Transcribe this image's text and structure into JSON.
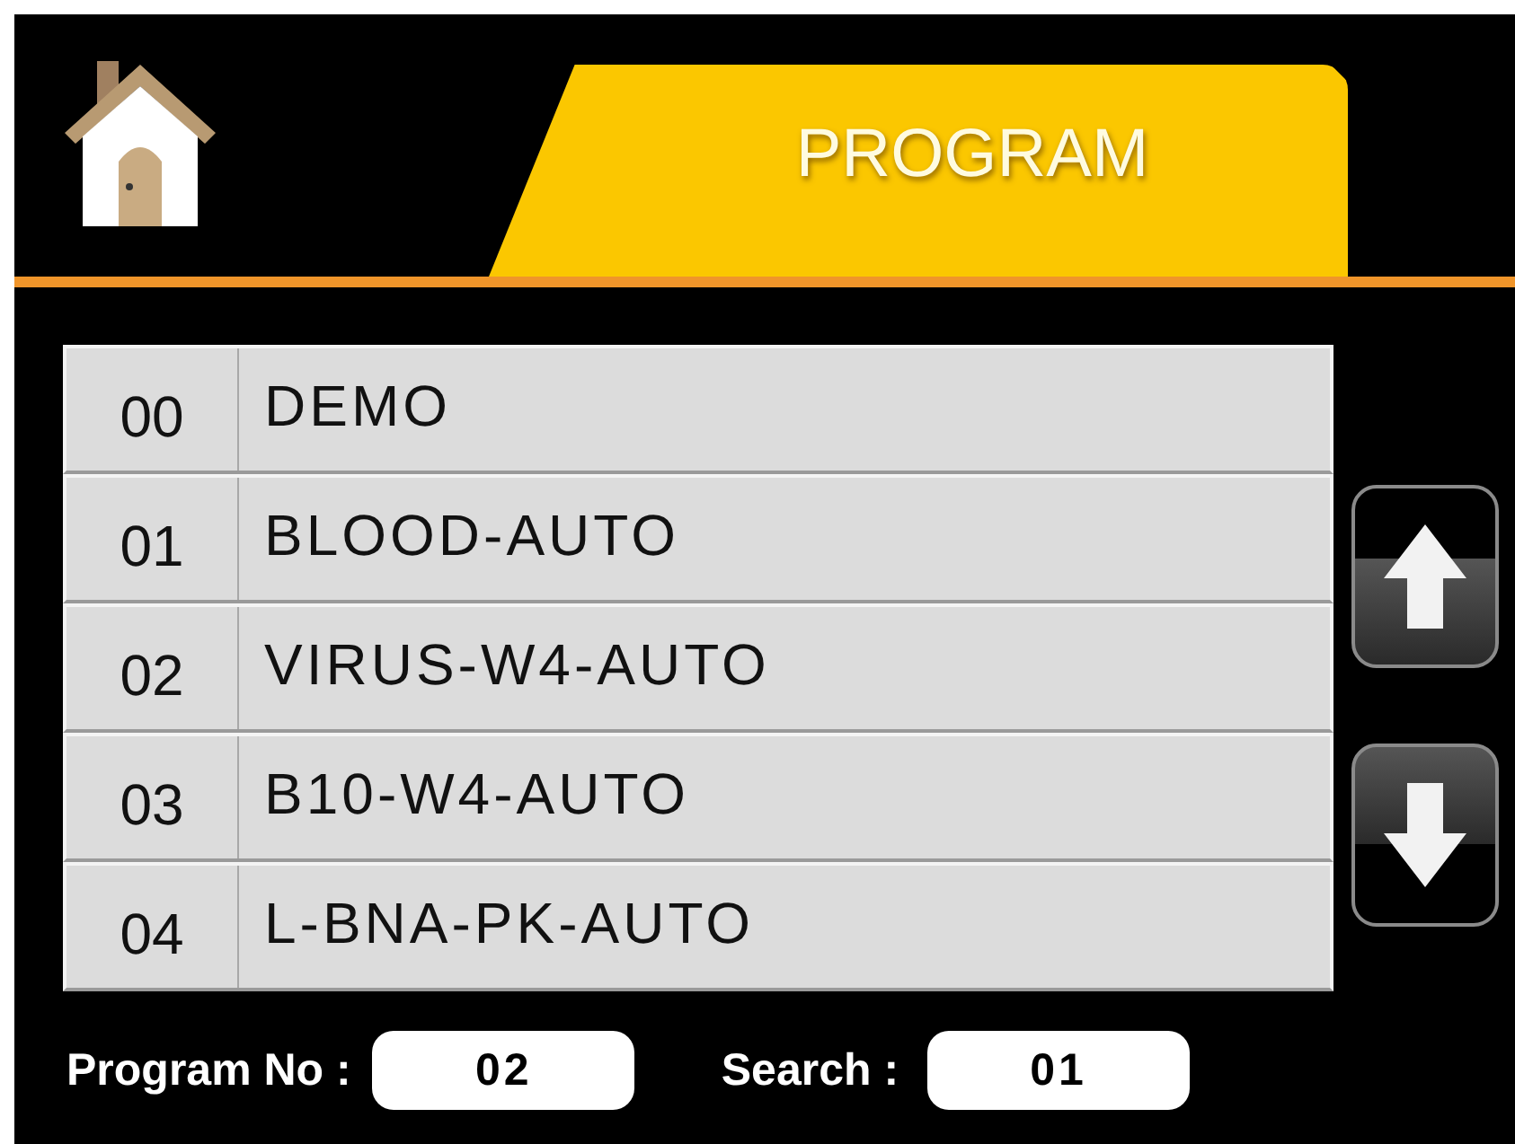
{
  "header": {
    "title": "PROGRAM"
  },
  "programs": [
    {
      "number": "00",
      "name": "DEMO"
    },
    {
      "number": "01",
      "name": "BLOOD-AUTO"
    },
    {
      "number": "02",
      "name": "VIRUS-W4-AUTO"
    },
    {
      "number": "03",
      "name": "B10-W4-AUTO"
    },
    {
      "number": "04",
      "name": "L-BNA-PK-AUTO"
    }
  ],
  "footer": {
    "program_no_label": "Program No :",
    "program_no": "02",
    "search_label": "Search :",
    "search": "01"
  }
}
